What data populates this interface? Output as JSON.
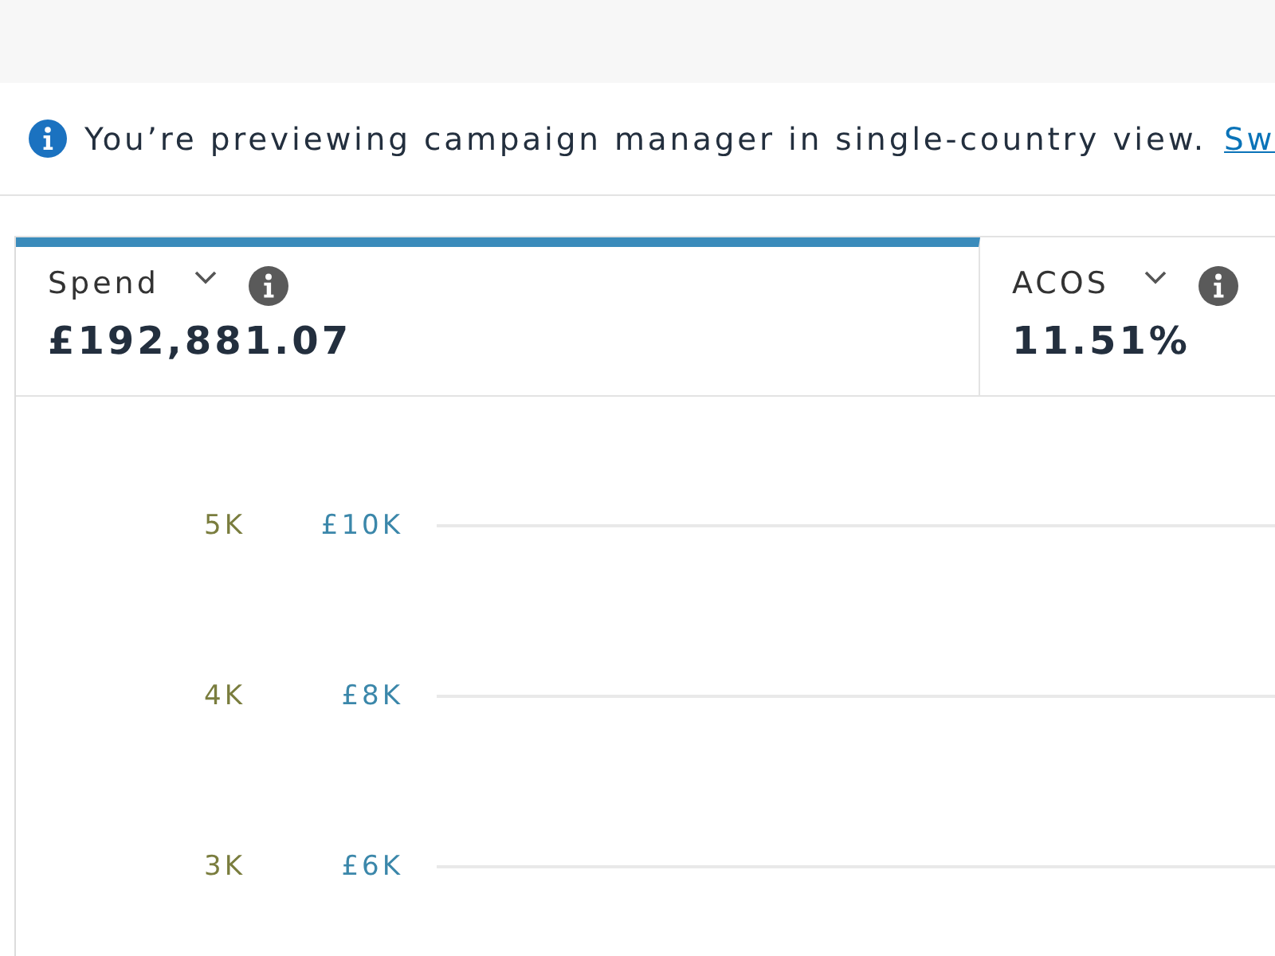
{
  "notice": {
    "text": "You’re previewing campaign manager in single-country view.",
    "link": "Sw"
  },
  "metric_tabs": [
    {
      "label": "Spend",
      "value": "£192,881.07",
      "selected": true
    },
    {
      "label": "ACOS",
      "value": "11.51%",
      "selected": false
    }
  ],
  "chart": {
    "tick_rows": [
      {
        "left": "5K",
        "right": "£10K"
      },
      {
        "left": "4K",
        "right": "£8K"
      },
      {
        "left": "3K",
        "right": "£6K"
      }
    ]
  }
}
